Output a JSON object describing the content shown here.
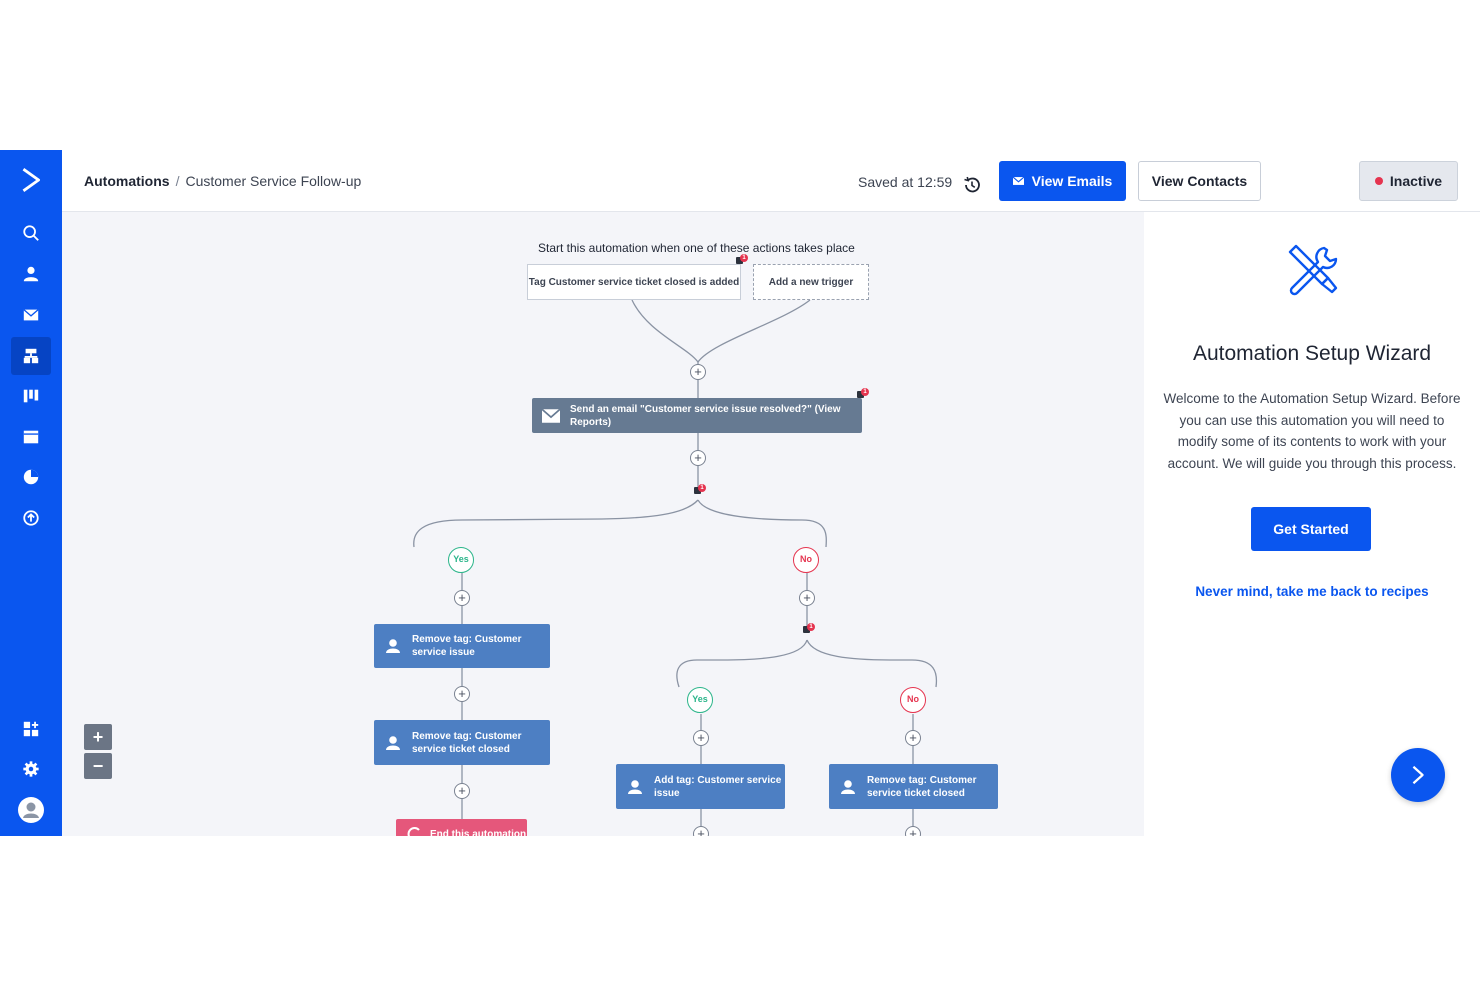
{
  "breadcrumb": {
    "root": "Automations",
    "separator": "/",
    "current": "Customer Service Follow-up"
  },
  "header": {
    "saved_text": "Saved at 12:59",
    "view_emails_label": "View Emails",
    "view_contacts_label": "View Contacts",
    "status_label": "Inactive"
  },
  "sidebar": {
    "items": [
      {
        "icon": "search-icon"
      },
      {
        "icon": "contacts-icon"
      },
      {
        "icon": "campaigns-icon"
      },
      {
        "icon": "automations-icon",
        "active": true
      },
      {
        "icon": "deals-icon"
      },
      {
        "icon": "website-icon"
      },
      {
        "icon": "reports-icon"
      },
      {
        "icon": "upgrade-icon"
      },
      {
        "icon": "apps-icon"
      },
      {
        "icon": "settings-icon"
      },
      {
        "icon": "profile-icon"
      }
    ]
  },
  "workflow": {
    "start_text": "Start this automation when one of these actions takes place",
    "trigger_label": "Tag Customer service ticket closed is added",
    "add_trigger_label": "Add a new trigger",
    "send_email_label": "Send an email \"Customer service issue resolved?\" (View Reports)",
    "yes_label": "Yes",
    "no_label": "No",
    "plus_symbol": "+",
    "remove_tag_issue": "Remove tag: Customer service issue",
    "remove_tag_closed": "Remove tag: Customer service ticket closed",
    "end_automation": "End this automation",
    "add_tag_issue": "Add tag: Customer service issue",
    "remove_tag_closed_right": "Remove tag: Customer service ticket closed",
    "badge_count": "1"
  },
  "zoom": {
    "in_label": "+",
    "out_label": "−"
  },
  "wizard": {
    "title": "Automation Setup Wizard",
    "text": "Welcome to the Automation Setup Wizard. Before you can use this automation you will need to modify some of its contents to work with your account. We will guide you through this process.",
    "button_label": "Get Started",
    "back_link": "Never mind, take me back to recipes"
  },
  "colors": {
    "brand": "#0a56ef",
    "node_gray": "#667a92",
    "node_blue": "#4d7fc3",
    "node_pink": "#e5577b",
    "yes": "#2bb58a",
    "no": "#e5344f"
  }
}
